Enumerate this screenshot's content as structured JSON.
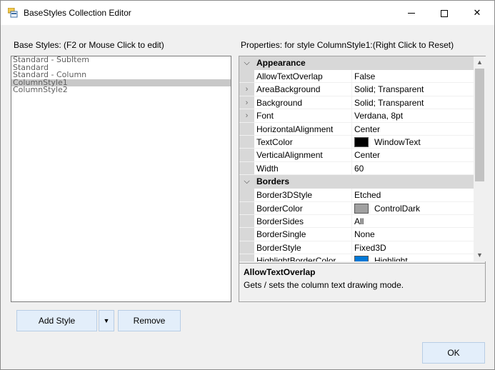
{
  "window": {
    "title": "BaseStyles Collection Editor",
    "minimize_glyph": "—",
    "maximize_glyph": "☐",
    "close_glyph": "✕"
  },
  "left": {
    "label": "Base Styles: (F2 or Mouse Click to edit)",
    "items": [
      {
        "label": "Standard - SubItem",
        "selected": false
      },
      {
        "label": "Standard",
        "selected": false
      },
      {
        "label": "Standard - Column",
        "selected": false
      },
      {
        "label": "ColumnStyle1",
        "selected": true
      },
      {
        "label": "ColumnStyle2",
        "selected": false
      }
    ]
  },
  "right": {
    "label": "Properties: for style ColumnStyle1:(Right Click to Reset)"
  },
  "grid": {
    "categories": [
      {
        "name": "Appearance",
        "glyph": "⌵",
        "rows": [
          {
            "name": "AllowTextOverlap",
            "value": "False",
            "expand": "",
            "selected": true
          },
          {
            "name": "AreaBackground",
            "value": "Solid; Transparent",
            "expand": "›"
          },
          {
            "name": "Background",
            "value": "Solid; Transparent",
            "expand": "›"
          },
          {
            "name": "Font",
            "value": "Verdana, 8pt",
            "expand": "›"
          },
          {
            "name": "HorizontalAlignment",
            "value": "Center",
            "expand": ""
          },
          {
            "name": "TextColor",
            "value": "WindowText",
            "expand": "",
            "swatch": "#000000"
          },
          {
            "name": "VerticalAlignment",
            "value": "Center",
            "expand": ""
          },
          {
            "name": "Width",
            "value": "60",
            "expand": ""
          }
        ]
      },
      {
        "name": "Borders",
        "glyph": "⌵",
        "rows": [
          {
            "name": "Border3DStyle",
            "value": "Etched",
            "expand": ""
          },
          {
            "name": "BorderColor",
            "value": "ControlDark",
            "expand": "",
            "swatch": "#a0a0a0"
          },
          {
            "name": "BorderSides",
            "value": "All",
            "expand": ""
          },
          {
            "name": "BorderSingle",
            "value": "None",
            "expand": ""
          },
          {
            "name": "BorderStyle",
            "value": "Fixed3D",
            "expand": ""
          },
          {
            "name": "HighlightBorderColor",
            "value": "Highlight",
            "expand": "",
            "swatch": "#0078d7"
          }
        ]
      }
    ],
    "scroll_up": "▲",
    "scroll_down": "▼"
  },
  "help": {
    "title": "AllowTextOverlap",
    "description": "Gets / sets the column text drawing mode."
  },
  "buttons": {
    "add_style": "Add Style",
    "dropdown": "▼",
    "remove": "Remove",
    "ok": "OK"
  }
}
